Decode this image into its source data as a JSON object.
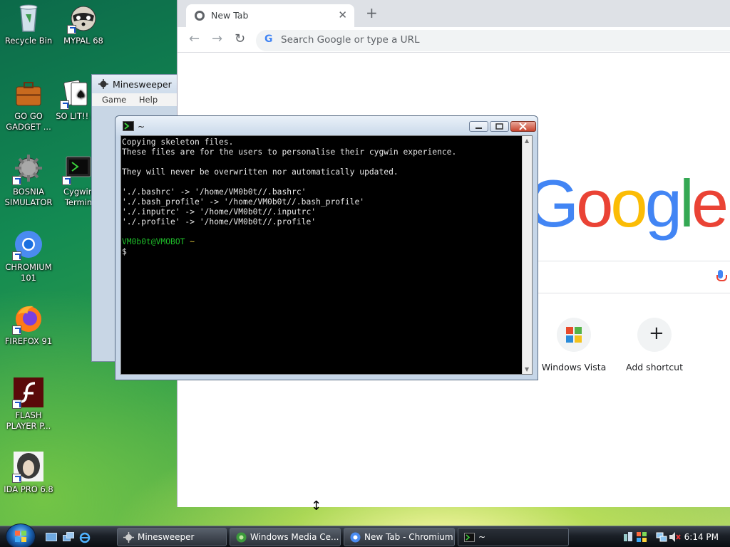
{
  "desktop": {
    "icons": [
      {
        "label": "Recycle Bin",
        "icon": "recycle-bin-icon"
      },
      {
        "label": "MYPAL 68",
        "icon": "raccoon-icon"
      },
      {
        "label": "GO GO GADGET ...",
        "icon": "briefcase-icon"
      },
      {
        "label": "SO LIT!! A",
        "icon": "cards-icon"
      },
      {
        "label": "BOSNIA SIMULATOR",
        "icon": "gear-icon"
      },
      {
        "label": "Cygwin Termin",
        "icon": "terminal-icon"
      },
      {
        "label": "CHROMIUM 101",
        "icon": "chromium-icon"
      },
      {
        "label": "FIREFOX 91",
        "icon": "firefox-icon"
      },
      {
        "label": "FLASH PLAYER P...",
        "icon": "flash-icon"
      },
      {
        "label": "IDA PRO 6.8",
        "icon": "ida-icon"
      }
    ]
  },
  "browser": {
    "tab_title": "New Tab",
    "tab_close": "✕",
    "new_tab": "+",
    "back": "←",
    "forward": "→",
    "reload": "↻",
    "omnibox_placeholder": "Search Google or type a URL",
    "logo_text": "Google",
    "shortcuts": [
      {
        "label": "Windows Vista",
        "icon": "vista-icon"
      },
      {
        "label": "Add shortcut",
        "icon": "plus-icon",
        "glyph": "+"
      }
    ]
  },
  "minesweeper": {
    "title": "Minesweeper",
    "menu": [
      "Game",
      "Help"
    ]
  },
  "terminal": {
    "title": "~",
    "lines": [
      {
        "text": "Copying skeleton files.",
        "color": "#e8e8e8"
      },
      {
        "text": "These files are for the users to personalise their cygwin experience.",
        "color": "#e8e8e8"
      },
      {
        "text": "",
        "color": "#e8e8e8"
      },
      {
        "text": "They will never be overwritten nor automatically updated.",
        "color": "#e8e8e8"
      },
      {
        "text": "",
        "color": "#e8e8e8"
      },
      {
        "text": "'./.bashrc' -> '/home/VM0b0t//.bashrc'",
        "color": "#e8e8e8"
      },
      {
        "text": "'./.bash_profile' -> '/home/VM0b0t//.bash_profile'",
        "color": "#e8e8e8"
      },
      {
        "text": "'./.inputrc' -> '/home/VM0b0t//.inputrc'",
        "color": "#e8e8e8"
      },
      {
        "text": "'./.profile' -> '/home/VM0b0t//.profile'",
        "color": "#e8e8e8"
      },
      {
        "text": "",
        "color": "#e8e8e8"
      }
    ],
    "prompt_user": "VM0b0t@VMOBOT",
    "prompt_dir": "~",
    "prompt_symbol": "$",
    "user_color": "#1fbf2a",
    "dir_color": "#d9c23a"
  },
  "taskbar": {
    "buttons": [
      {
        "label": "Minesweeper",
        "icon": "minesweeper-icon"
      },
      {
        "label": "Windows Media Ce...",
        "icon": "media-center-icon"
      },
      {
        "label": "New Tab - Chromium",
        "icon": "chromium-icon"
      },
      {
        "label": "~",
        "icon": "terminal-icon"
      }
    ],
    "clock": "6:14 PM"
  }
}
